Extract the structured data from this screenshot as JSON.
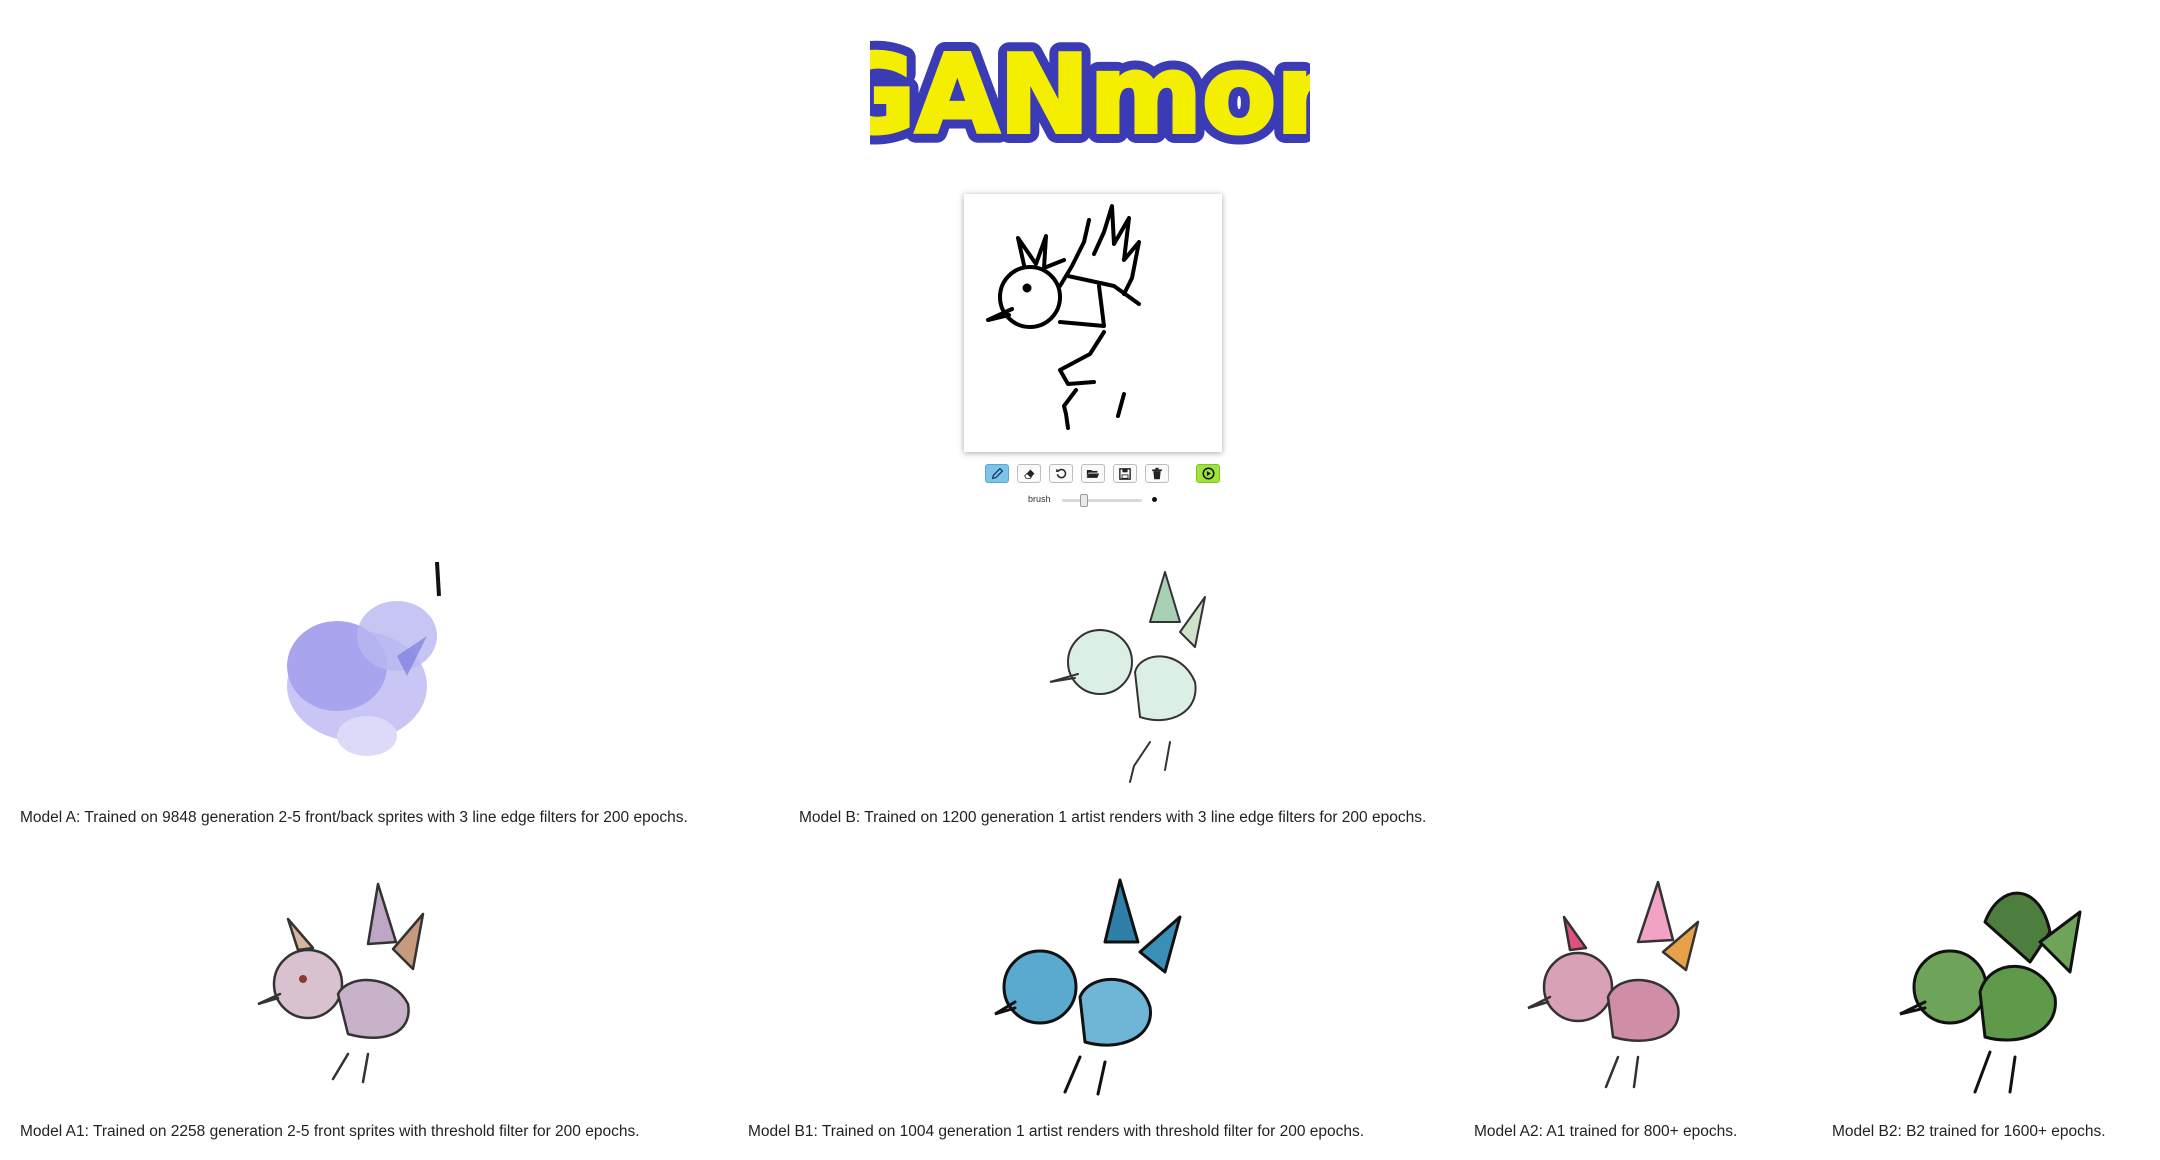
{
  "app": {
    "logo_text": "GANmon"
  },
  "toolbar": {
    "tools": [
      {
        "name": "pencil",
        "icon": "pencil-icon",
        "active": true
      },
      {
        "name": "eraser",
        "icon": "eraser-icon"
      },
      {
        "name": "undo",
        "icon": "undo-icon"
      },
      {
        "name": "open",
        "icon": "folder-open-icon"
      },
      {
        "name": "save",
        "icon": "save-icon"
      },
      {
        "name": "clear",
        "icon": "trash-icon"
      }
    ],
    "generate_icon": "play-circle-icon",
    "brush_label": "brush",
    "brush_size": 0.25
  },
  "results": [
    {
      "id": "A",
      "caption": "Model A: Trained on 9848 generation 2-5 front/back sprites with 3 line edge filters for 200 epochs.",
      "tint": "#a9a4ee",
      "accent": "#6f72d8"
    },
    {
      "id": "B",
      "caption": "Model B: Trained on 1200 generation 1 artist renders with 3 line edge filters for 200 epochs.",
      "tint": "#dcefe5",
      "accent": "#a7d0b4"
    },
    {
      "id": "A1",
      "caption": "Model A1: Trained on 2258 generation 2-5 front sprites with threshold filter for 200 epochs.",
      "tint": "#d8c2cf",
      "accent": "#c69a7c"
    },
    {
      "id": "B1",
      "caption": "Model B1: Trained on 1004 generation 1 artist renders with threshold filter for 200 epochs.",
      "tint": "#5aa9cf",
      "accent": "#2f7fa8"
    },
    {
      "id": "A2",
      "caption": "Model A2: A1 trained for 800+ epochs.",
      "tint": "#d9a1b8",
      "accent": "#e04f80"
    },
    {
      "id": "B2",
      "caption": "Model B2: B2 trained for 1600+ epochs.",
      "tint": "#6ea35a",
      "accent": "#4e7e3d"
    }
  ]
}
